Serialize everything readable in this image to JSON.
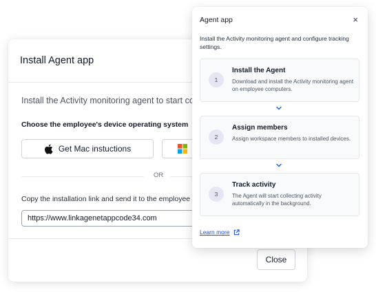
{
  "install_modal": {
    "title": "Install Agent app",
    "intro": "Install the Activity monitoring agent to start collecting",
    "os_label": "Choose the employee's device operating system",
    "help_icon": "?",
    "mac_button_label": "Get Mac instuctions",
    "or_text": "OR",
    "copy_label": "Copy the installation link and send it to the employee",
    "link_value": "https://www.linkagenetappcode34.com",
    "close_label": "Close"
  },
  "agent_panel": {
    "title": "Agent app",
    "close_icon": "×",
    "description": "Install the Activity monitoring agent and configure tracking settings.",
    "steps": [
      {
        "number": "1",
        "title": "Install the Agent",
        "description": "Download and install the Activity monitoring agent on employee computers."
      },
      {
        "number": "2",
        "title": "Assign members",
        "description": "Assign workspace members to installed devices."
      },
      {
        "number": "3",
        "title": "Track activity",
        "description": "The Agent will start collecting activity automatically in the background."
      }
    ],
    "learn_more": "Learn more"
  },
  "colors": {
    "accent": "#2563eb",
    "step_badge": "#e4e6f4",
    "ms_red": "#f25022",
    "ms_green": "#7fba00",
    "ms_blue": "#00a4ef",
    "ms_yellow": "#ffb900"
  },
  "icons": [
    "apple-icon",
    "windows-icon",
    "help-icon",
    "close-icon",
    "chevron-down-icon",
    "external-link-icon"
  ]
}
